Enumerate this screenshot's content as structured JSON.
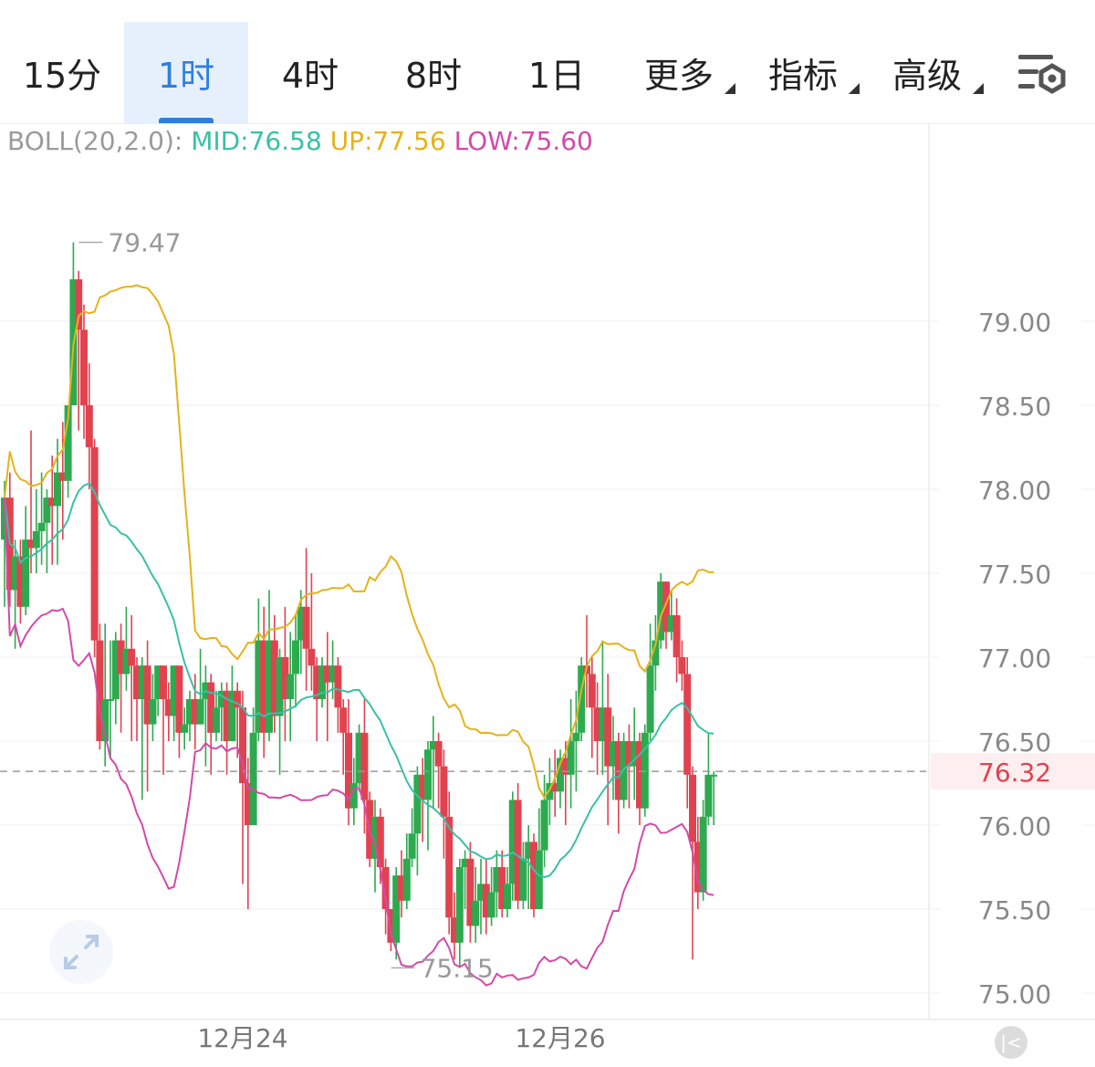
{
  "tabs": [
    {
      "label": "15分",
      "active": false,
      "dropdown": false
    },
    {
      "label": "1时",
      "active": true,
      "dropdown": false
    },
    {
      "label": "4时",
      "active": false,
      "dropdown": false
    },
    {
      "label": "8时",
      "active": false,
      "dropdown": false
    },
    {
      "label": "1日",
      "active": false,
      "dropdown": false
    },
    {
      "label": "更多",
      "active": false,
      "dropdown": true
    },
    {
      "label": "指标",
      "active": false,
      "dropdown": true
    },
    {
      "label": "高级",
      "active": false,
      "dropdown": true
    }
  ],
  "indicator": {
    "name": "BOLL(20,2.0):",
    "mid": "MID:76.58",
    "up": "UP:77.56",
    "low": "LOW:75.60"
  },
  "colors": {
    "up_candle": "#2daa4f",
    "down_candle": "#e0434f",
    "mid_line": "#38c1a6",
    "up_line": "#e6b219",
    "low_line": "#d34aa8",
    "accent": "#2f7fe0",
    "current_price": "#e0434f"
  },
  "chart_data": {
    "type": "candlestick",
    "y_ticks": [
      "79.00",
      "78.50",
      "78.00",
      "77.50",
      "77.00",
      "76.50",
      "76.00",
      "75.50",
      "75.00"
    ],
    "y_tick_values": [
      79.0,
      78.5,
      78.0,
      77.5,
      77.0,
      76.5,
      76.0,
      75.5,
      75.0
    ],
    "ylim": [
      74.85,
      79.85
    ],
    "x_labels": [
      {
        "label": "12月24",
        "index": 45
      },
      {
        "label": "12月26",
        "index": 105
      }
    ],
    "current_price": {
      "label": "76.32",
      "value": 76.32
    },
    "high_marker": {
      "label": "79.47",
      "value": 79.47,
      "index": 13
    },
    "low_marker": {
      "label": "75.15",
      "value": 75.15,
      "index": 72
    },
    "candles": [
      [
        77.7,
        77.95,
        77.3,
        78.05
      ],
      [
        77.95,
        77.4,
        77.3,
        78.1
      ],
      [
        77.4,
        77.6,
        77.05,
        77.7
      ],
      [
        77.6,
        77.3,
        77.2,
        77.7
      ],
      [
        77.3,
        77.7,
        77.25,
        77.9
      ],
      [
        77.7,
        77.65,
        77.5,
        78.35
      ],
      [
        77.65,
        77.75,
        77.5,
        78.0
      ],
      [
        77.75,
        77.8,
        77.55,
        78.1
      ],
      [
        77.8,
        77.95,
        77.5,
        78.0
      ],
      [
        77.95,
        77.9,
        77.55,
        78.2
      ],
      [
        77.9,
        78.1,
        77.55,
        78.3
      ],
      [
        78.1,
        78.05,
        77.7,
        78.4
      ],
      [
        78.05,
        78.5,
        77.95,
        78.5
      ],
      [
        78.5,
        79.25,
        78.5,
        79.47
      ],
      [
        79.25,
        78.95,
        78.35,
        79.3
      ],
      [
        78.95,
        78.5,
        78.3,
        79.1
      ],
      [
        78.5,
        78.25,
        78.0,
        78.75
      ],
      [
        78.25,
        77.1,
        77.0,
        78.3
      ],
      [
        77.1,
        76.5,
        76.45,
        77.2
      ],
      [
        76.5,
        76.75,
        76.35,
        77.2
      ],
      [
        76.75,
        76.75,
        76.4,
        77.1
      ],
      [
        76.75,
        77.1,
        76.6,
        77.15
      ],
      [
        77.1,
        76.9,
        76.55,
        77.2
      ],
      [
        76.9,
        77.05,
        76.8,
        77.3
      ],
      [
        77.05,
        76.95,
        76.5,
        77.25
      ],
      [
        76.95,
        76.75,
        76.5,
        77.0
      ],
      [
        76.75,
        76.95,
        76.15,
        77.0
      ],
      [
        76.95,
        76.6,
        76.2,
        77.1
      ],
      [
        76.6,
        76.75,
        76.5,
        76.9
      ],
      [
        76.75,
        76.95,
        76.65,
        76.95
      ],
      [
        76.95,
        76.75,
        76.3,
        76.95
      ],
      [
        76.75,
        76.65,
        76.5,
        76.85
      ],
      [
        76.65,
        76.95,
        76.5,
        76.95
      ],
      [
        76.95,
        76.55,
        76.4,
        76.95
      ],
      [
        76.55,
        76.6,
        76.45,
        76.7
      ],
      [
        76.6,
        76.75,
        76.5,
        76.8
      ],
      [
        76.75,
        76.6,
        76.45,
        76.9
      ],
      [
        76.6,
        76.75,
        76.6,
        77.05
      ],
      [
        76.75,
        76.85,
        76.35,
        76.95
      ],
      [
        76.85,
        76.55,
        76.3,
        76.9
      ],
      [
        76.55,
        76.7,
        76.5,
        76.8
      ],
      [
        76.7,
        76.8,
        76.5,
        76.85
      ],
      [
        76.8,
        76.5,
        76.3,
        76.85
      ],
      [
        76.5,
        76.8,
        76.5,
        76.95
      ],
      [
        76.8,
        76.7,
        76.4,
        76.85
      ],
      [
        76.7,
        76.25,
        75.65,
        76.8
      ],
      [
        76.25,
        76.0,
        75.5,
        76.4
      ],
      [
        76.0,
        76.55,
        76.0,
        76.7
      ],
      [
        76.55,
        77.1,
        76.5,
        77.35
      ],
      [
        77.1,
        76.55,
        76.4,
        77.3
      ],
      [
        76.55,
        77.1,
        76.5,
        77.4
      ],
      [
        77.1,
        76.65,
        76.55,
        77.25
      ],
      [
        76.65,
        77.0,
        76.3,
        77.05
      ],
      [
        77.0,
        76.75,
        76.5,
        77.3
      ],
      [
        76.75,
        76.9,
        76.5,
        77.15
      ],
      [
        76.9,
        77.1,
        76.7,
        77.25
      ],
      [
        77.1,
        77.3,
        76.9,
        77.4
      ],
      [
        77.3,
        77.05,
        76.8,
        77.65
      ],
      [
        77.05,
        76.95,
        76.8,
        77.5
      ],
      [
        76.95,
        76.75,
        76.5,
        77.0
      ],
      [
        76.75,
        76.95,
        76.7,
        77.0
      ],
      [
        76.95,
        76.85,
        76.5,
        77.15
      ],
      [
        76.85,
        76.95,
        76.75,
        77.1
      ],
      [
        76.95,
        76.7,
        76.55,
        77.0
      ],
      [
        76.7,
        76.55,
        76.3,
        76.75
      ],
      [
        76.55,
        76.1,
        76.0,
        76.75
      ],
      [
        76.1,
        76.25,
        76.0,
        76.4
      ],
      [
        76.25,
        76.55,
        76.2,
        76.6
      ],
      [
        76.55,
        76.15,
        75.95,
        76.75
      ],
      [
        76.15,
        75.8,
        75.75,
        76.2
      ],
      [
        75.8,
        76.05,
        75.6,
        76.15
      ],
      [
        76.05,
        75.75,
        75.65,
        76.1
      ],
      [
        75.75,
        75.5,
        75.35,
        75.8
      ],
      [
        75.5,
        75.3,
        75.25,
        75.45
      ],
      [
        75.3,
        75.7,
        75.2,
        75.75
      ],
      [
        75.7,
        75.55,
        75.45,
        75.85
      ],
      [
        75.55,
        75.8,
        75.5,
        75.95
      ],
      [
        75.8,
        75.95,
        75.75,
        76.1
      ],
      [
        75.95,
        76.3,
        75.7,
        76.35
      ],
      [
        76.3,
        76.15,
        75.9,
        76.4
      ],
      [
        76.15,
        76.45,
        75.85,
        76.5
      ],
      [
        76.45,
        76.5,
        76.1,
        76.65
      ],
      [
        76.5,
        76.35,
        76.1,
        76.55
      ],
      [
        76.35,
        76.05,
        75.8,
        76.45
      ],
      [
        76.05,
        75.45,
        75.35,
        76.2
      ],
      [
        75.45,
        75.3,
        75.2,
        75.6
      ],
      [
        75.3,
        75.75,
        75.15,
        75.8
      ],
      [
        75.75,
        75.8,
        75.5,
        75.85
      ],
      [
        75.8,
        75.4,
        75.3,
        75.9
      ],
      [
        75.4,
        75.55,
        75.3,
        75.75
      ],
      [
        75.55,
        75.65,
        75.35,
        75.8
      ],
      [
        75.65,
        75.45,
        75.35,
        75.8
      ],
      [
        75.45,
        75.6,
        75.4,
        75.75
      ],
      [
        75.6,
        75.75,
        75.45,
        75.85
      ],
      [
        75.75,
        75.5,
        75.45,
        75.85
      ],
      [
        75.5,
        75.65,
        75.45,
        75.75
      ],
      [
        75.65,
        76.15,
        75.55,
        76.2
      ],
      [
        76.15,
        75.55,
        75.5,
        76.25
      ],
      [
        75.55,
        75.8,
        75.5,
        75.9
      ],
      [
        75.8,
        75.9,
        75.5,
        76.0
      ],
      [
        75.9,
        75.5,
        75.45,
        75.95
      ],
      [
        75.5,
        75.85,
        75.5,
        76.1
      ],
      [
        75.85,
        76.15,
        75.75,
        76.3
      ],
      [
        76.15,
        76.25,
        76.0,
        76.4
      ],
      [
        76.25,
        76.2,
        76.05,
        76.45
      ],
      [
        76.2,
        76.4,
        76.1,
        76.45
      ],
      [
        76.4,
        76.3,
        76.0,
        76.5
      ],
      [
        76.3,
        76.5,
        76.1,
        76.75
      ],
      [
        76.5,
        76.55,
        76.2,
        76.8
      ],
      [
        76.55,
        76.95,
        76.5,
        77.0
      ],
      [
        76.95,
        76.9,
        76.7,
        77.25
      ],
      [
        76.9,
        76.7,
        76.4,
        77.0
      ],
      [
        76.7,
        76.5,
        76.3,
        76.85
      ],
      [
        76.5,
        76.7,
        76.3,
        77.1
      ],
      [
        76.7,
        76.35,
        76.0,
        76.9
      ],
      [
        76.35,
        76.5,
        76.15,
        76.65
      ],
      [
        76.5,
        76.15,
        75.95,
        76.55
      ],
      [
        76.15,
        76.5,
        76.1,
        76.55
      ],
      [
        76.5,
        76.35,
        76.1,
        76.6
      ],
      [
        76.35,
        76.5,
        76.15,
        76.7
      ],
      [
        76.5,
        76.1,
        76.0,
        76.55
      ],
      [
        76.1,
        76.55,
        76.05,
        76.6
      ],
      [
        76.55,
        76.95,
        76.5,
        77.2
      ],
      [
        76.95,
        77.1,
        76.8,
        77.25
      ],
      [
        77.1,
        77.45,
        77.05,
        77.5
      ],
      [
        77.45,
        77.15,
        77.05,
        77.45
      ],
      [
        77.15,
        77.25,
        77.1,
        77.4
      ],
      [
        77.25,
        77.0,
        76.85,
        77.35
      ],
      [
        77.0,
        76.9,
        76.8,
        77.1
      ],
      [
        76.9,
        76.3,
        76.1,
        77.0
      ],
      [
        76.3,
        75.9,
        75.2,
        76.35
      ],
      [
        75.9,
        75.6,
        75.5,
        76.05
      ],
      [
        75.6,
        76.05,
        75.55,
        76.15
      ],
      [
        76.05,
        76.3,
        76.0,
        76.55
      ],
      [
        76.3,
        76.3,
        76.0,
        76.32
      ]
    ]
  }
}
